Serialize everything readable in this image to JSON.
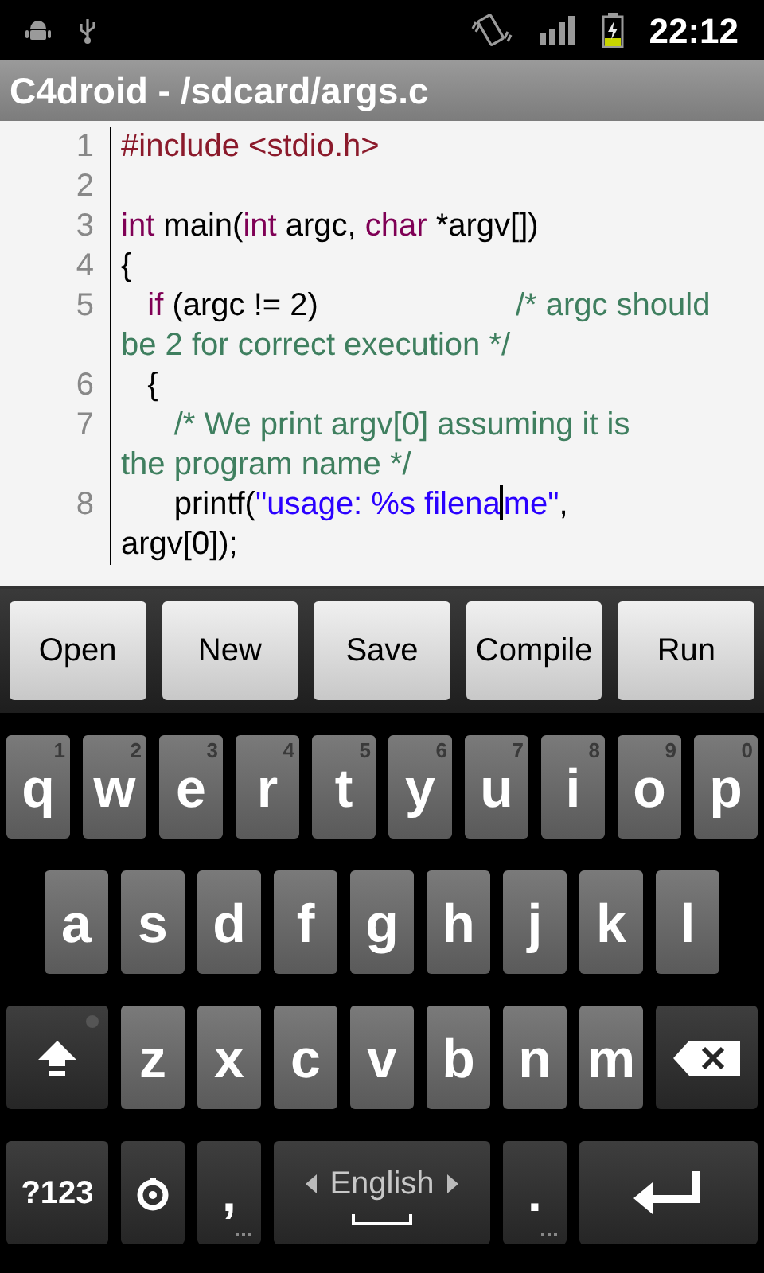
{
  "status_bar": {
    "time": "22:12"
  },
  "title_bar": {
    "title": "C4droid - /sdcard/args.c"
  },
  "editor": {
    "rows": [
      {
        "number": "1",
        "tokens": [
          {
            "kind": "preprocessor",
            "text": "#include <stdio.h>"
          }
        ]
      },
      {
        "number": "2"
      },
      {
        "number": "3",
        "tokens": [
          {
            "kind": "keyword",
            "text": "int"
          },
          {
            "kind": "plain",
            "text": " main("
          },
          {
            "kind": "keyword",
            "text": "int"
          },
          {
            "kind": "plain",
            "text": " argc, "
          },
          {
            "kind": "keyword",
            "text": "char"
          },
          {
            "kind": "plain",
            "text": " *argv[])"
          }
        ]
      },
      {
        "number": "4",
        "tokens": [
          {
            "kind": "plain",
            "text": "{"
          }
        ]
      },
      {
        "number": "5",
        "tokens": [
          {
            "kind": "keyword",
            "text": "   if"
          },
          {
            "kind": "plain",
            "text": " (argc != 2)"
          },
          {
            "kind": "tab"
          },
          {
            "kind": "comment",
            "text": "/* argc should"
          }
        ]
      },
      {
        "tokens": [
          {
            "kind": "comment",
            "text": "be 2 for correct execution */"
          }
        ]
      },
      {
        "number": "6",
        "tokens": [
          {
            "kind": "plain",
            "text": "   {"
          }
        ]
      },
      {
        "number": "7",
        "tokens": [
          {
            "kind": "comment",
            "text": "      /* We print argv[0] assuming it is"
          }
        ]
      },
      {
        "tokens": [
          {
            "kind": "comment",
            "text": "the program name */"
          }
        ]
      },
      {
        "number": "8",
        "tokens": [
          {
            "kind": "plain",
            "text": "      printf("
          },
          {
            "kind": "string",
            "text": "\"usage: %s filena"
          },
          {
            "kind": "cursor"
          },
          {
            "kind": "string",
            "text": "me\""
          },
          {
            "kind": "plain",
            "text": ","
          }
        ]
      },
      {
        "tokens": [
          {
            "kind": "plain",
            "text": "argv[0]);"
          }
        ]
      }
    ]
  },
  "buttons": [
    "Open",
    "New",
    "Save",
    "Compile",
    "Run"
  ],
  "keyboard": {
    "letter_rows": [
      {
        "keys": [
          {
            "kind": "letter",
            "label": "q",
            "hint": "1"
          },
          {
            "kind": "letter",
            "label": "w",
            "hint": "2"
          },
          {
            "kind": "letter",
            "label": "e",
            "hint": "3"
          },
          {
            "kind": "letter",
            "label": "r",
            "hint": "4"
          },
          {
            "kind": "letter",
            "label": "t",
            "hint": "5"
          },
          {
            "kind": "letter",
            "label": "y",
            "hint": "6"
          },
          {
            "kind": "letter",
            "label": "u",
            "hint": "7"
          },
          {
            "kind": "letter",
            "label": "i",
            "hint": "8"
          },
          {
            "kind": "letter",
            "label": "o",
            "hint": "9"
          },
          {
            "kind": "letter",
            "label": "p",
            "hint": "0"
          }
        ]
      },
      {
        "keys": [
          {
            "kind": "letter",
            "label": "a"
          },
          {
            "kind": "letter",
            "label": "s"
          },
          {
            "kind": "letter",
            "label": "d"
          },
          {
            "kind": "letter",
            "label": "f"
          },
          {
            "kind": "letter",
            "label": "g"
          },
          {
            "kind": "letter",
            "label": "h"
          },
          {
            "kind": "letter",
            "label": "j"
          },
          {
            "kind": "letter",
            "label": "k"
          },
          {
            "kind": "letter",
            "label": "l"
          }
        ]
      },
      {
        "keys": [
          {
            "kind": "shift"
          },
          {
            "kind": "letter",
            "label": "z"
          },
          {
            "kind": "letter",
            "label": "x"
          },
          {
            "kind": "letter",
            "label": "c"
          },
          {
            "kind": "letter",
            "label": "v"
          },
          {
            "kind": "letter",
            "label": "b"
          },
          {
            "kind": "letter",
            "label": "n"
          },
          {
            "kind": "letter",
            "label": "m"
          },
          {
            "kind": "delete"
          }
        ]
      }
    ],
    "bottom_row": [
      {
        "kind": "symbols",
        "label": "?123"
      },
      {
        "kind": "settings"
      },
      {
        "kind": "punct",
        "label": ","
      },
      {
        "kind": "space",
        "label": "English"
      },
      {
        "kind": "punct",
        "label": "."
      },
      {
        "kind": "enter"
      }
    ]
  }
}
